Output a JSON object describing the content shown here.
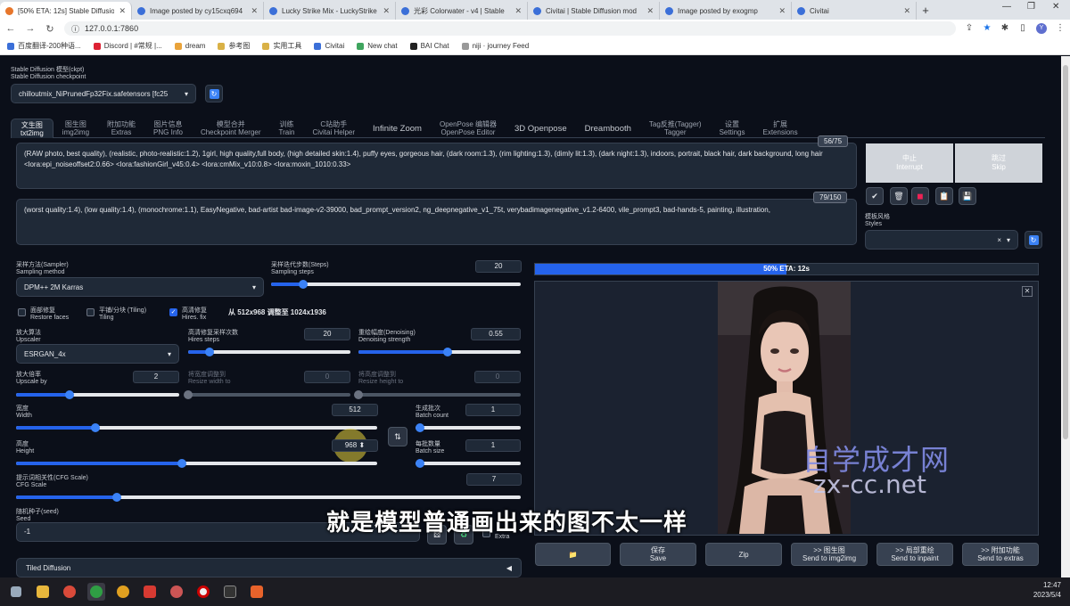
{
  "browser": {
    "tabs": [
      {
        "title": "[50% ETA: 12s] Stable Diffusio",
        "active": true
      },
      {
        "title": "Image posted by cy15cxq694"
      },
      {
        "title": "Lucky Strike Mix - LuckyStrike"
      },
      {
        "title": "光彩 Colorwater - v4 | Stable"
      },
      {
        "title": "Civitai | Stable Diffusion mod"
      },
      {
        "title": "Image posted by exogmp"
      },
      {
        "title": "Civitai"
      }
    ],
    "url": "127.0.0.1:7860",
    "profile_initial": "Y",
    "bookmarks": [
      "百度翻译-200种语...",
      "Discord | #常规 |...",
      "dream",
      "参考图",
      "实用工具",
      "Civitai",
      "New chat",
      "BAI Chat",
      "niji · journey Feed"
    ]
  },
  "checkpoint": {
    "label_cn": "Stable Diffusion 模型(ckpt)",
    "label_en": "Stable Diffusion checkpoint",
    "value": "chilloutmix_NiPrunedFp32Fix.safetensors [fc25"
  },
  "main_tabs": [
    {
      "cn": "文生图",
      "en": "txt2img",
      "active": true
    },
    {
      "cn": "图生图",
      "en": "img2img"
    },
    {
      "cn": "附加功能",
      "en": "Extras"
    },
    {
      "cn": "图片信息",
      "en": "PNG Info"
    },
    {
      "cn": "模型合并",
      "en": "Checkpoint Merger"
    },
    {
      "cn": "训练",
      "en": "Train"
    },
    {
      "cn": "C站助手",
      "en": "Civitai Helper"
    },
    {
      "single": "Infinite Zoom"
    },
    {
      "cn": "OpenPose 编辑器",
      "en": "OpenPose Editor"
    },
    {
      "single": "3D Openpose"
    },
    {
      "single": "Dreambooth"
    },
    {
      "cn": "Tag反推(Tagger)",
      "en": "Tagger"
    },
    {
      "cn": "设置",
      "en": "Settings"
    },
    {
      "cn": "扩展",
      "en": "Extensions"
    }
  ],
  "prompt": {
    "text": "(RAW photo, best quality), (realistic, photo-realistic:1.2), 1girl, high quality,full body,  (high detailed skin:1.4), puffy eyes, gorgeous hair, (dark room:1.3), (rim lighting:1.3), (dimly lit:1.3), (dark night:1.3), indoors, portrait, black hair, dark background, long hair <lora:epi_noiseoffset2:0.66> <lora:fashionGirl_v45:0.4> <lora:cmMix_v10:0.8>  <lora:moxin_1010:0.33>",
    "counter": "56/75"
  },
  "negative": {
    "text": "(worst quality:1.4), (low quality:1.4), (monochrome:1.1), EasyNegative, bad-artist bad-image-v2-39000, bad_prompt_version2, ng_deepnegative_v1_75t, verybadimagenegative_v1.2-6400, vile_prompt3, bad-hands-5, painting, illustration,",
    "counter": "79/150"
  },
  "actions": {
    "interrupt_cn": "中止",
    "interrupt_en": "Interrupt",
    "skip_cn": "跳过",
    "skip_en": "Skip",
    "styles_cn": "模板风格",
    "styles_en": "Styles",
    "styles_clear": "×"
  },
  "sampler": {
    "method_cn": "采样方法(Sampler)",
    "method_en": "Sampling method",
    "method_value": "DPM++ 2M Karras",
    "steps_cn": "采样迭代步数(Steps)",
    "steps_en": "Sampling steps",
    "steps_value": "20",
    "steps_fraction": 0.13
  },
  "checkboxes": {
    "restore_cn": "面部修复",
    "restore_en": "Restore faces",
    "tiling_cn": "平铺/分块 (Tiling)",
    "tiling_en": "Tiling",
    "hires_cn": "高清修复",
    "hires_en": "Hires. fix",
    "hires_checked": true,
    "hires_info": "从 512x968 调整至 1024x1936"
  },
  "hires": {
    "upscaler_cn": "放大算法",
    "upscaler_en": "Upscaler",
    "upscaler_value": "ESRGAN_4x",
    "hires_steps_cn": "高清修复采样次数",
    "hires_steps_en": "Hires steps",
    "hires_steps_value": "20",
    "hires_steps_fraction": 0.13,
    "denoise_cn": "重绘幅度(Denoising)",
    "denoise_en": "Denoising strength",
    "denoise_value": "0.55",
    "denoise_fraction": 0.55,
    "upscale_cn": "放大倍率",
    "upscale_en": "Upscale by",
    "upscale_value": "2",
    "upscale_fraction": 0.33,
    "resize_w_cn": "将宽度调整到",
    "resize_w_en": "Resize width to",
    "resize_w_value": "0",
    "resize_h_cn": "将高度调整到",
    "resize_h_en": "Resize height to",
    "resize_h_value": "0"
  },
  "size": {
    "width_cn": "宽度",
    "width_en": "Width",
    "width_value": "512",
    "width_fraction": 0.22,
    "height_cn": "高度",
    "height_en": "Height",
    "height_value": "968",
    "height_fraction": 0.46,
    "batch_count_cn": "生成批次",
    "batch_count_en": "Batch count",
    "batch_count_value": "1",
    "batch_size_cn": "每批数量",
    "batch_size_en": "Batch size",
    "batch_size_value": "1"
  },
  "cfg": {
    "label_cn": "提示词相关性(CFG Scale)",
    "label_en": "CFG Scale",
    "value": "7",
    "fraction": 0.2
  },
  "seed": {
    "label_cn": "随机种子(seed)",
    "label_en": "Seed",
    "value": "-1",
    "extra_label": "Extra"
  },
  "tiled": {
    "label": "Tiled Diffusion",
    "arrow": "◀"
  },
  "progress": {
    "text": "50% ETA: 12s",
    "fraction": 0.5
  },
  "watermark": {
    "cn": "自学成才网",
    "en": "zx-cc.net"
  },
  "subtitle": "就是模型普通画出来的图不太一样",
  "output_buttons": [
    {
      "cn": "",
      "en": "📁"
    },
    {
      "cn": "保存",
      "en": "Save"
    },
    {
      "cn": "Zip",
      "en": ""
    },
    {
      "cn": ">> 图生图",
      "en": "Send to img2img"
    },
    {
      "cn": ">> 局部重绘",
      "en": "Send to inpaint"
    },
    {
      "cn": ">> 附加功能",
      "en": "Send to extras"
    }
  ],
  "clock": {
    "time": "12:47",
    "date": "2023/5/4"
  }
}
